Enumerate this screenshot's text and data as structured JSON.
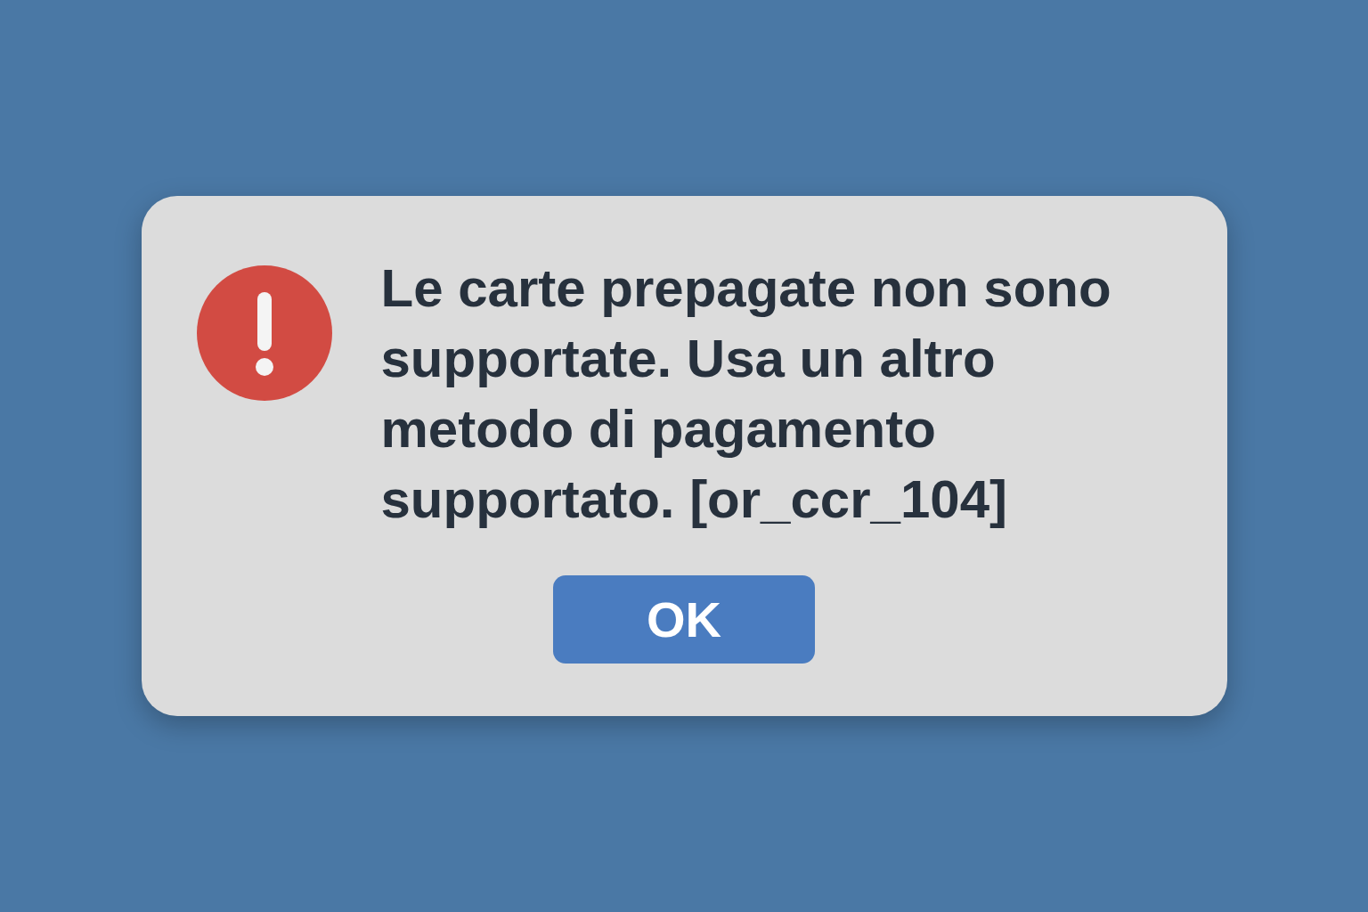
{
  "dialog": {
    "kind": "error",
    "message": "Le carte prepagate non sono supportate. Usa un altro metodo di pagamento supportato. [or_ccr_104]",
    "buttons": [
      "OK"
    ]
  }
}
